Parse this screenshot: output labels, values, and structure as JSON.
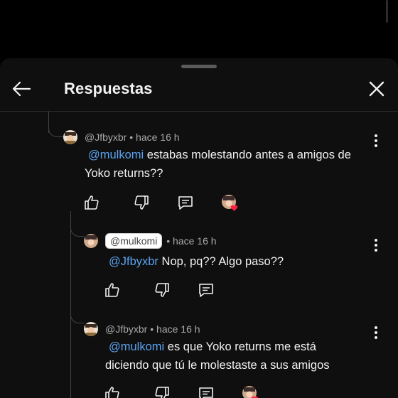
{
  "header": {
    "title": "Respuestas"
  },
  "comments": [
    {
      "username": "@Jfbyxbr",
      "time": "hace 16 h",
      "mention": "@mulkomi",
      "text_line1": "estabas molestando antes a amigos de",
      "text_line2": "Yoko returns??"
    },
    {
      "username_chip": "@mulkomi",
      "time": "hace 16 h",
      "mention": "@Jfbyxbr",
      "text_line1": "Nop, pq?? Algo paso??"
    },
    {
      "username": "@Jfbyxbr",
      "time": "hace 16 h",
      "mention": "@mulkomi",
      "text_line1": "es que Yoko returns me está",
      "text_line2": "diciendo que tú le molestaste a sus amigos"
    }
  ],
  "icons": {
    "back": "arrow-left-icon",
    "close": "close-icon",
    "like": "thumbs-up-icon",
    "dislike": "thumbs-down-icon",
    "reply": "reply-icon",
    "more": "more-vertical-icon"
  },
  "colors": {
    "accent_link": "#5aa3f0",
    "heart": "#ff1d3f",
    "sheet_bg": "#0f0f0f"
  }
}
